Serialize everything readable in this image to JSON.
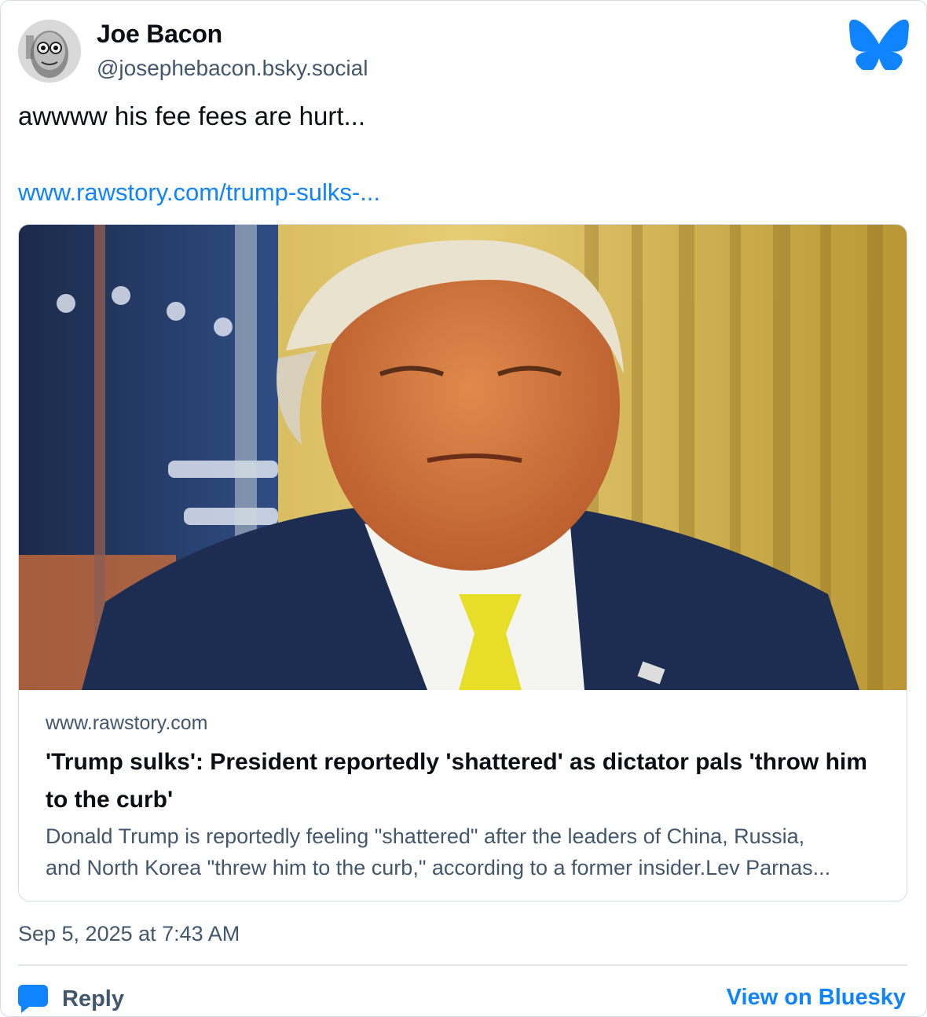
{
  "author": {
    "display_name": "Joe Bacon",
    "handle": "@josephebacon.bsky.social",
    "avatar_icon": "avatar-photo"
  },
  "brand": {
    "logo_icon": "bluesky-butterfly-icon",
    "accent_color": "#1083fe"
  },
  "post": {
    "text": "awwww his fee fees are hurt...",
    "link_text": "www.rawstory.com/trump-sulks-..."
  },
  "embed": {
    "image_icon": "article-thumbnail-image",
    "domain": "www.rawstory.com",
    "title": "'Trump sulks': President reportedly 'shattered' as dictator pals 'throw him to the curb'",
    "description_line1": "Donald Trump is reportedly feeling \"shattered\" after the leaders of China, Russia,",
    "description_line2": "and North Korea \"threw him to the curb,\" according to a former insider.Lev Parnas..."
  },
  "meta": {
    "timestamp": "Sep 5, 2025 at 7:43 AM"
  },
  "actions": {
    "reply_label": "Reply",
    "reply_icon": "speech-bubble-icon",
    "view_on_label": "View on Bluesky"
  }
}
